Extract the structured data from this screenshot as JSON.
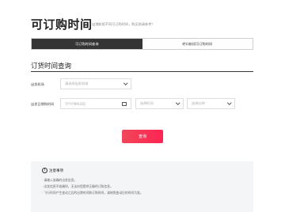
{
  "header": {
    "title": "可订购时间",
    "subtitle": "出港航班不同可订购时间，购买前请参考！"
  },
  "tabs": [
    {
      "label": "可订购时间查询",
      "active": true
    },
    {
      "label": "转口航班可订购时间",
      "active": false
    }
  ],
  "section": {
    "title": "订货时间查询"
  },
  "form": {
    "departure_label": "出发机场",
    "departure_placeholder": "请选择出发机场",
    "date_label": "出发日期和时间",
    "date_placeholder": "YYYY.MM.DD",
    "hour_placeholder": "选择时间",
    "minute_placeholder": "选择分钟"
  },
  "query_button": "查询",
  "notice": {
    "title": "注意事项",
    "items": [
      "· 请输入准确的出发信息。",
      "· 出发信息不准确时，无法向您提供正确的订购信息。",
      "· 飞行时间产生变动之后的出港时间和订购时间，请按照变动后的时间为准。"
    ]
  },
  "colors": {
    "accent": "#f73a55",
    "active_tab": "#353535",
    "notice_bg": "#f3f5f7"
  }
}
